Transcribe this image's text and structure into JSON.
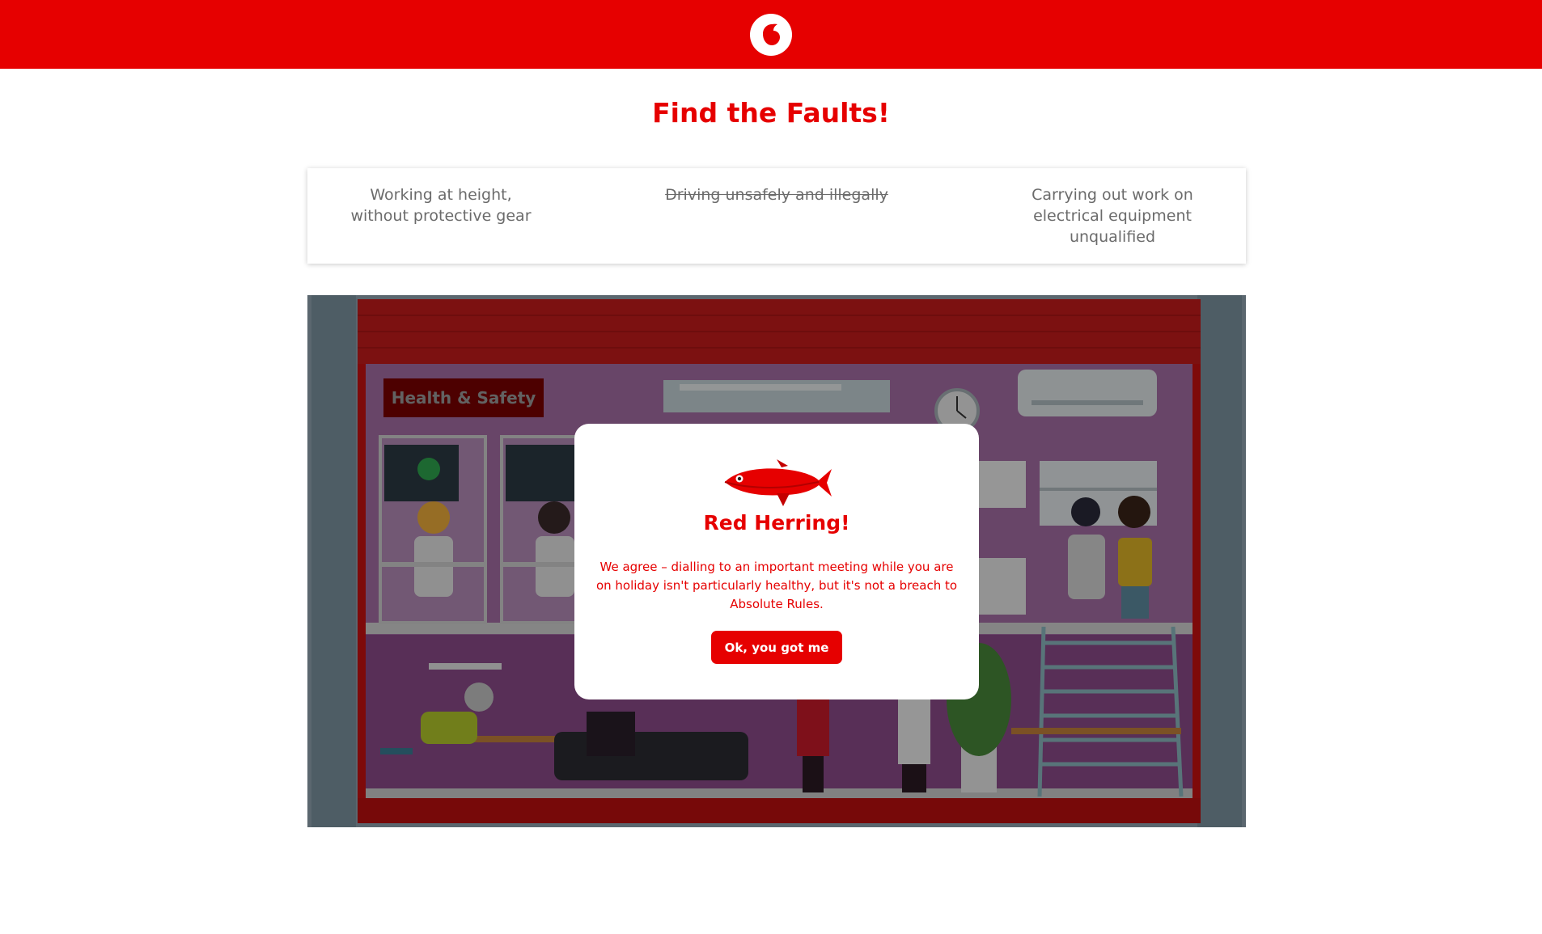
{
  "header": {
    "logo_icon": "vodafone-speechmark-logo",
    "brand_color": "#e60000"
  },
  "page": {
    "title": "Find the Faults!"
  },
  "faults": [
    {
      "label": "Working at height, without protective gear",
      "struck": false
    },
    {
      "label": "Driving unsafely and illegally",
      "struck": true
    },
    {
      "label": "Carrying out work on electrical equipment unqualified",
      "struck": false
    }
  ],
  "scene": {
    "sign_label": "Health & Safety",
    "illustration": "office-scene-illustration"
  },
  "modal": {
    "icon": "red-herring-fish-icon",
    "title": "Red Herring!",
    "message": "We agree – dialling to an important meeting while you are on holiday isn't particularly healthy, but it's not a breach to Absolute Rules.",
    "button_label": "Ok, you got me"
  }
}
